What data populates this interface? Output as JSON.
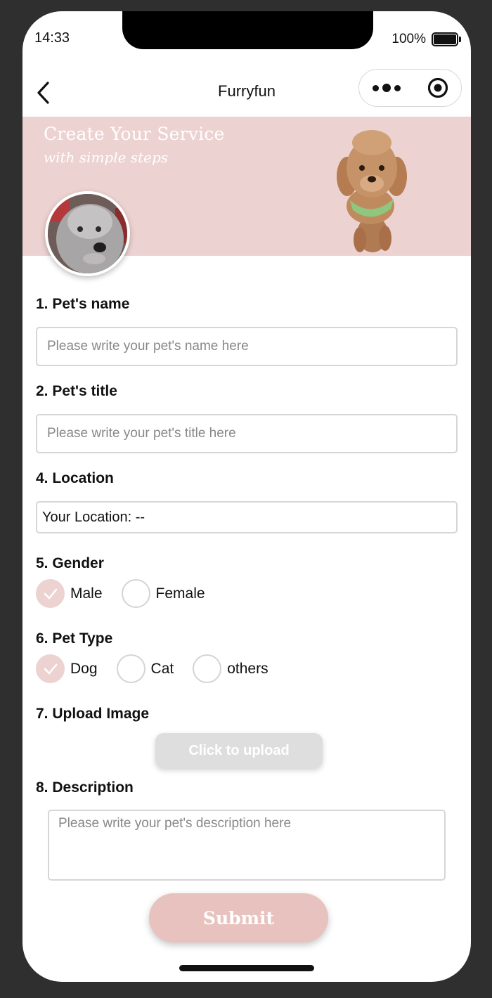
{
  "status_bar": {
    "time": "14:33",
    "battery": "100%"
  },
  "nav": {
    "title": "Furryfun",
    "back_icon": "chevron-left-icon",
    "more_icon": "more-dots-icon",
    "close_icon": "target-circle-icon"
  },
  "banner": {
    "title": "Create Your Service",
    "subtitle": "with simple steps",
    "background": "#ecd3d1"
  },
  "form": {
    "name": {
      "label": "1. Pet's name",
      "placeholder": "Please write your pet's name here",
      "value": ""
    },
    "title": {
      "label": "2. Pet's title",
      "placeholder": "Please write your pet's title here",
      "value": ""
    },
    "location": {
      "label": "4. Location",
      "value": "Your Location: --"
    },
    "gender": {
      "label": "5. Gender",
      "options": [
        {
          "label": "Male",
          "checked": true
        },
        {
          "label": "Female",
          "checked": false
        }
      ]
    },
    "pet_type": {
      "label": "6. Pet Type",
      "options": [
        {
          "label": "Dog",
          "checked": true
        },
        {
          "label": "Cat",
          "checked": false
        },
        {
          "label": "others",
          "checked": false
        }
      ]
    },
    "upload": {
      "label": "7. Upload Image",
      "button": "Click to upload"
    },
    "description": {
      "label": "8. Description",
      "placeholder": "Please write your pet's description here",
      "value": ""
    },
    "submit": "Submit"
  },
  "colors": {
    "accent": "#ecd3d1",
    "submit": "#e8c2bf",
    "upload_button": "#dedede",
    "check": "#ffffff"
  }
}
